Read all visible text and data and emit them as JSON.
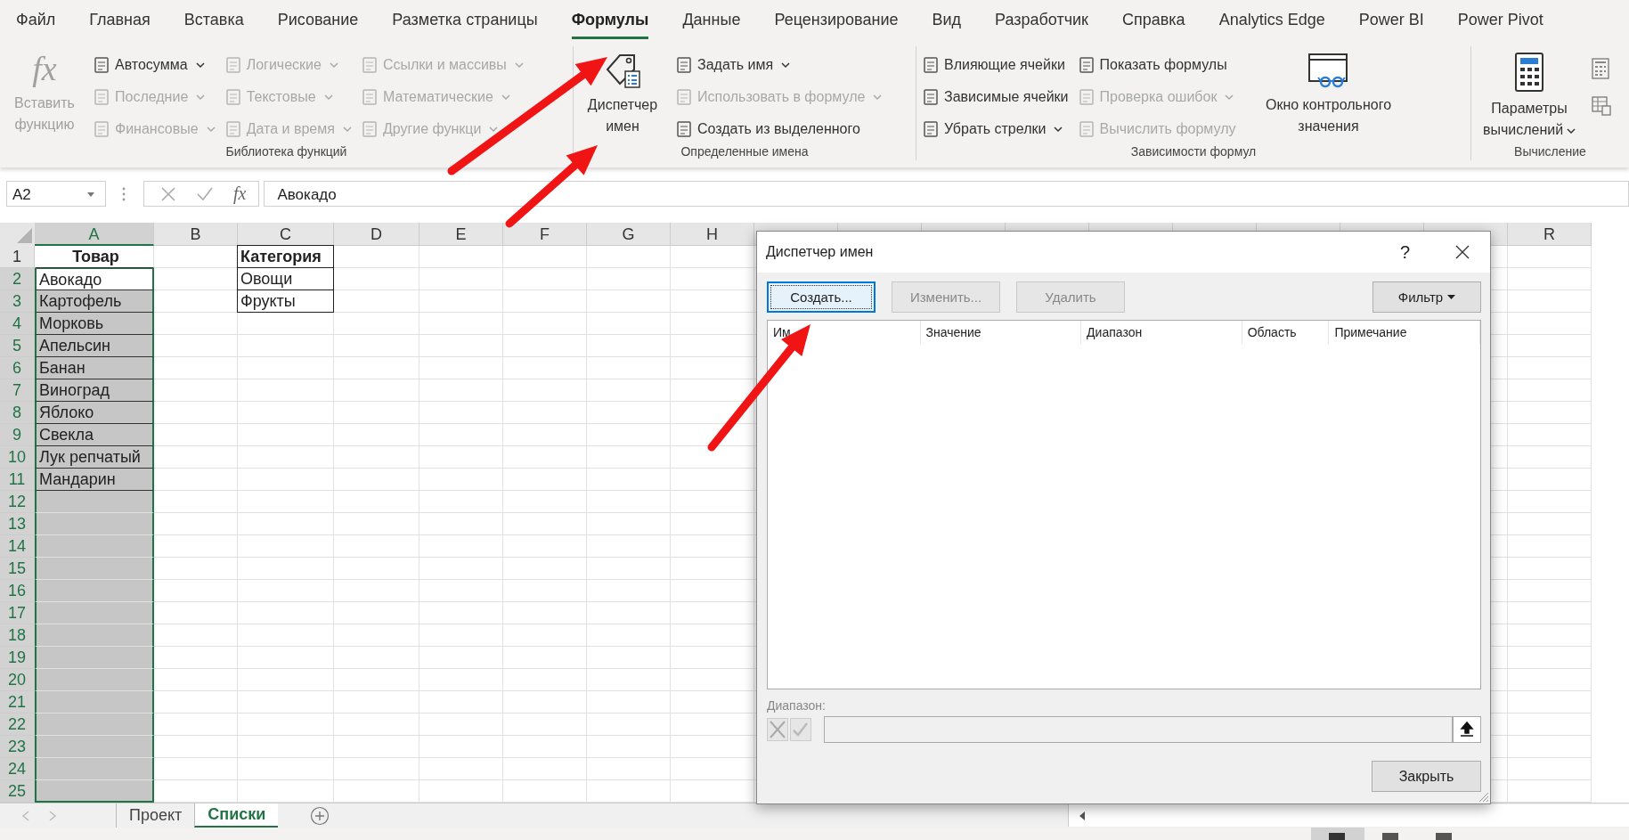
{
  "menu_tabs": [
    {
      "label": "Файл",
      "selected": false
    },
    {
      "label": "Главная",
      "selected": false
    },
    {
      "label": "Вставка",
      "selected": false
    },
    {
      "label": "Рисование",
      "selected": false
    },
    {
      "label": "Разметка страницы",
      "selected": false
    },
    {
      "label": "Формулы",
      "selected": true
    },
    {
      "label": "Данные",
      "selected": false
    },
    {
      "label": "Рецензирование",
      "selected": false
    },
    {
      "label": "Вид",
      "selected": false
    },
    {
      "label": "Разработчик",
      "selected": false
    },
    {
      "label": "Справка",
      "selected": false
    },
    {
      "label": "Analytics Edge",
      "selected": false
    },
    {
      "label": "Power BI",
      "selected": false
    },
    {
      "label": "Power Pivot",
      "selected": false
    }
  ],
  "ribbon": {
    "groups": [
      {
        "label": "Библиотека функций",
        "items": [
          {
            "kind": "large",
            "glyph": "fx",
            "label": "Вставить функцию",
            "disabled": true,
            "dropdown": false
          },
          {
            "kind": "column",
            "items": [
              {
                "label": "Автосумма",
                "disabled": false,
                "dropdown": true
              },
              {
                "label": "Последние",
                "disabled": true,
                "dropdown": true
              },
              {
                "label": "Финансовые",
                "disabled": true,
                "dropdown": true
              }
            ]
          },
          {
            "kind": "column",
            "items": [
              {
                "label": "Логические",
                "disabled": true,
                "dropdown": true
              },
              {
                "label": "Текстовые",
                "disabled": true,
                "dropdown": true
              },
              {
                "label": "Дата и время",
                "disabled": true,
                "dropdown": true
              }
            ]
          },
          {
            "kind": "column",
            "items": [
              {
                "label": "Ссылки и массивы",
                "disabled": true,
                "dropdown": true
              },
              {
                "label": "Математические",
                "disabled": true,
                "dropdown": true
              },
              {
                "label": "Другие функци",
                "disabled": true,
                "dropdown": true
              }
            ]
          }
        ]
      },
      {
        "label": "Определенные имена",
        "items": [
          {
            "kind": "large",
            "label": "Диспетчер имен",
            "disabled": false,
            "dropdown": false
          },
          {
            "kind": "column",
            "items": [
              {
                "label": "Задать имя",
                "disabled": false,
                "dropdown": true
              },
              {
                "label": "Использовать в формуле",
                "disabled": true,
                "dropdown": true
              },
              {
                "label": "Создать из выделенного",
                "disabled": false,
                "dropdown": false
              }
            ]
          }
        ]
      },
      {
        "label": "Зависимости формул",
        "items": [
          {
            "kind": "column",
            "items": [
              {
                "label": "Влияющие ячейки",
                "disabled": false,
                "dropdown": false
              },
              {
                "label": "Зависимые ячейки",
                "disabled": false,
                "dropdown": false
              },
              {
                "label": "Убрать стрелки",
                "disabled": false,
                "dropdown": true
              }
            ]
          },
          {
            "kind": "column",
            "items": [
              {
                "label": "Показать формулы",
                "disabled": false,
                "dropdown": false
              },
              {
                "label": "Проверка ошибок",
                "disabled": true,
                "dropdown": true
              },
              {
                "label": "Вычислить формулу",
                "disabled": true,
                "dropdown": false
              }
            ]
          },
          {
            "kind": "large",
            "label": "Окно контрольного значения",
            "disabled": false,
            "dropdown": false
          }
        ]
      },
      {
        "label": "Вычисление",
        "items": [
          {
            "kind": "large",
            "label": "Параметры вычислений",
            "disabled": false,
            "dropdown": true
          },
          {
            "kind": "icon_stack"
          }
        ]
      }
    ]
  },
  "formula_bar": {
    "name_box": "A2",
    "function_glyph": "fx",
    "value": "Авокадо"
  },
  "columns": [
    {
      "label": "A",
      "selected": true
    },
    {
      "label": "B",
      "selected": false
    },
    {
      "label": "C",
      "selected": false
    },
    {
      "label": "D",
      "selected": false
    },
    {
      "label": "E",
      "selected": false
    },
    {
      "label": "F",
      "selected": false
    },
    {
      "label": "G",
      "selected": false
    },
    {
      "label": "H",
      "selected": false
    },
    {
      "selected": false
    },
    {
      "selected": false
    },
    {
      "selected": false
    },
    {
      "selected": false
    },
    {
      "selected": false
    },
    {
      "selected": false
    },
    {
      "selected": false
    },
    {
      "selected": false
    },
    {
      "selected": false
    },
    {
      "label": "R",
      "selected": false
    }
  ],
  "rows": [
    {
      "number": "1",
      "selected": false,
      "a": {
        "text": "Товар",
        "bold": true,
        "active": false
      },
      "c": {
        "text": "Категория",
        "bold": true
      }
    },
    {
      "number": "2",
      "selected": true,
      "a": {
        "text": "Авокадо",
        "bold": false,
        "active": true
      },
      "c": {
        "text": "Овощи",
        "bold": false
      }
    },
    {
      "number": "3",
      "selected": true,
      "a": {
        "text": "Картофель",
        "bold": false,
        "active": false
      },
      "c": {
        "text": "Фрукты",
        "bold": false
      }
    },
    {
      "number": "4",
      "selected": true,
      "a": {
        "text": "Морковь",
        "bold": false,
        "active": false
      }
    },
    {
      "number": "5",
      "selected": true,
      "a": {
        "text": "Апельсин",
        "bold": false,
        "active": false
      }
    },
    {
      "number": "6",
      "selected": true,
      "a": {
        "text": "Банан",
        "bold": false,
        "active": false
      }
    },
    {
      "number": "7",
      "selected": true,
      "a": {
        "text": "Виноград",
        "bold": false,
        "active": false
      }
    },
    {
      "number": "8",
      "selected": true,
      "a": {
        "text": "Яблоко",
        "bold": false,
        "active": false
      }
    },
    {
      "number": "9",
      "selected": true,
      "a": {
        "text": "Свекла",
        "bold": false,
        "active": false
      }
    },
    {
      "number": "10",
      "selected": true,
      "a": {
        "text": "Лук репчатый",
        "bold": false,
        "active": false
      }
    },
    {
      "number": "11",
      "selected": true,
      "a": {
        "text": "Мандарин",
        "bold": false,
        "active": false
      }
    },
    {
      "number": "12",
      "selected": true
    },
    {
      "number": "13",
      "selected": true
    },
    {
      "number": "14",
      "selected": true
    },
    {
      "number": "15",
      "selected": true
    },
    {
      "number": "16",
      "selected": true
    },
    {
      "number": "17",
      "selected": true
    },
    {
      "number": "18",
      "selected": true
    },
    {
      "number": "19",
      "selected": true
    },
    {
      "number": "20",
      "selected": true
    },
    {
      "number": "21",
      "selected": true
    },
    {
      "number": "22",
      "selected": true
    },
    {
      "number": "23",
      "selected": true
    },
    {
      "number": "24",
      "selected": true
    },
    {
      "number": "25",
      "selected": true
    }
  ],
  "sheet_tabs": [
    {
      "label": "Проект",
      "selected": false
    },
    {
      "label": "Списки",
      "selected": true
    }
  ],
  "dialog": {
    "title": "Диспетчер имен",
    "help_glyph": "?",
    "buttons": [
      {
        "label": "Создать...",
        "disabled": false,
        "focused": true
      },
      {
        "label": "Изменить...",
        "disabled": true,
        "focused": false
      },
      {
        "label": "Удалить",
        "disabled": true,
        "focused": false
      }
    ],
    "filter_button": "Фильтр",
    "list_columns": [
      "Им",
      "Значение",
      "Диапазон",
      "Область",
      "Примечание"
    ],
    "range_label": "Диапазон:",
    "close_button": "Закрыть"
  }
}
